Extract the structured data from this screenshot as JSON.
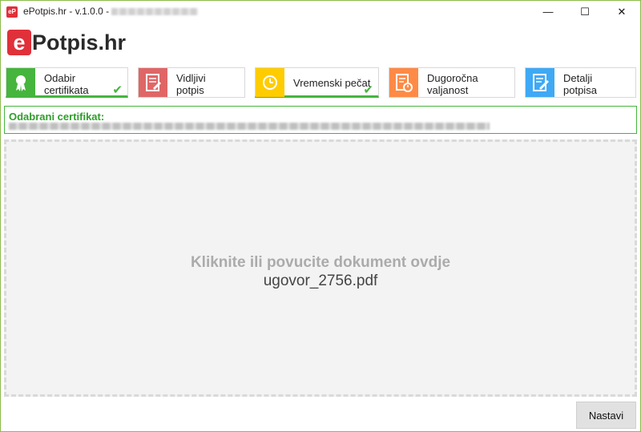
{
  "window": {
    "title": "ePotpis.hr - v.1.0.0 -",
    "icon_text": "eP",
    "buttons": {
      "minimize": "—",
      "maximize": "☐",
      "close": "✕"
    }
  },
  "logo": {
    "e": "e",
    "rest": "Potpis.hr"
  },
  "steps": [
    {
      "line1": "Odabir",
      "line2": "certifikata",
      "color": "#45b53d",
      "icon": "award-ribbon-icon",
      "active": true,
      "done": true
    },
    {
      "line1": "Vidljivi",
      "line2": "potpis",
      "color": "#e06666",
      "icon": "signed-document-icon",
      "active": false,
      "done": false
    },
    {
      "line1": "Vremenski pečat",
      "line2": "",
      "color": "#ffcc00",
      "icon": "clock-icon",
      "active": true,
      "done": true
    },
    {
      "line1": "Dugoročna",
      "line2": "valjanost",
      "color": "#ff8a45",
      "icon": "document-clock-icon",
      "active": false,
      "done": false
    },
    {
      "line1": "Detalji",
      "line2": "potpisa",
      "color": "#3fa9f5",
      "icon": "edit-document-icon",
      "active": false,
      "done": false
    }
  ],
  "check_mark": "✔",
  "certificate": {
    "title": "Odabrani certifikat:"
  },
  "dropzone": {
    "hint": "Kliknite ili povucite dokument ovdje",
    "file": "ugovor_2756.pdf"
  },
  "footer": {
    "next_label": "Nastavi"
  }
}
